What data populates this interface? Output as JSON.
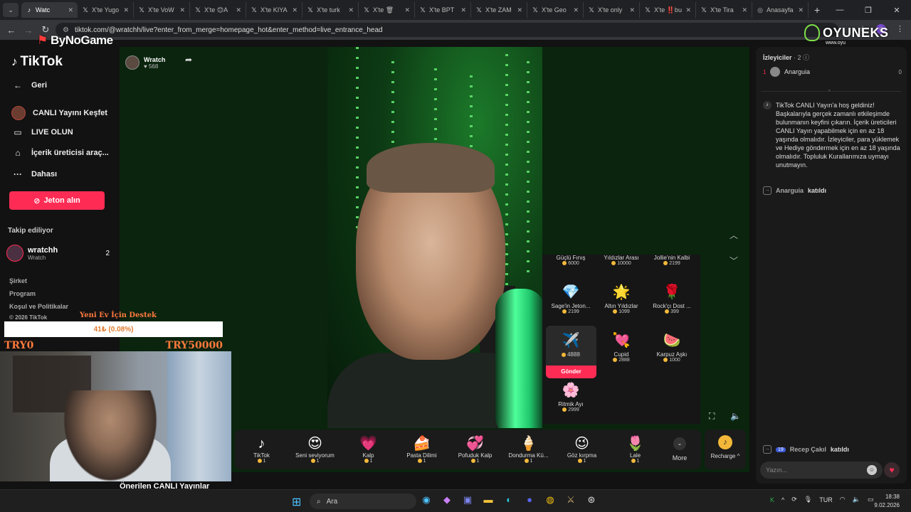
{
  "browser": {
    "tabs": [
      {
        "icon": "tiktok",
        "label": "Watc",
        "active": true
      },
      {
        "icon": "x",
        "label": "X'te Yugo"
      },
      {
        "icon": "x",
        "label": "X'te VoW"
      },
      {
        "icon": "x",
        "label": "X'te 😊A"
      },
      {
        "icon": "x",
        "label": "X'te KIYA"
      },
      {
        "icon": "x",
        "label": "X'te turk"
      },
      {
        "icon": "x",
        "label": "X'te 🗑"
      },
      {
        "icon": "x",
        "label": "X'te BPT"
      },
      {
        "icon": "x",
        "label": "X'te ZAM"
      },
      {
        "icon": "x",
        "label": "X'te Geo"
      },
      {
        "icon": "x",
        "label": "X'te only"
      },
      {
        "icon": "x",
        "label": "X'te ‼️bu"
      },
      {
        "icon": "x",
        "label": "X'te Tira"
      },
      {
        "icon": "globe",
        "label": "Anasayfa"
      }
    ],
    "url": "tiktok.com/@wratchh/live?enter_from_merge=homepage_hot&enter_method=live_entrance_head",
    "profile_initial": "C"
  },
  "overlay": {
    "bynogame": "ByNoGame",
    "oyuneks_brand": "OYUNEKS",
    "oyuneks_sub": "www.oyu",
    "donation_title": "Yeni Ev İçin Destek",
    "donation_progress": "41₺ (0.08%)",
    "donation_min": "TRY0",
    "donation_max": "TRY50000",
    "suggested_live": "Önerilen CANLI Yayınlar"
  },
  "sidebar": {
    "logo": "TikTok",
    "back": "Geri",
    "items": [
      {
        "icon": "avatar",
        "label": "CANLI Yayını Keşfet"
      },
      {
        "icon": "camera-icon",
        "label": "LIVE OLUN"
      },
      {
        "icon": "creator-icon",
        "label": "İçerik üreticisi araç..."
      },
      {
        "icon": "more-icon",
        "label": "Dahası"
      }
    ],
    "coin_button": "Jeton alın",
    "following_header": "Takip ediliyor",
    "followed_user": {
      "name": "wratchh",
      "sub": "Wratch",
      "count": "2"
    },
    "footer": [
      "Şirket",
      "Program",
      "Koşul ve Politikalar",
      "© 2026 TikTok"
    ]
  },
  "stream": {
    "host_name": "Wratch",
    "host_likes": "568"
  },
  "gift_panel": {
    "row0": [
      {
        "name": "Güçlü Fınış",
        "price": "6000"
      },
      {
        "name": "Yıldızlar Arası",
        "price": "10000"
      },
      {
        "name": "Jollie'nin Kalbi",
        "price": "2199"
      }
    ],
    "row1": [
      {
        "icon": "💎",
        "name": "Sage'in Jeton...",
        "price": "2199"
      },
      {
        "icon": "🌟",
        "name": "Altın Yıldızlar",
        "price": "1099"
      },
      {
        "icon": "🌹",
        "name": "Rock'çı Dost ...",
        "price": "399"
      }
    ],
    "row2": [
      {
        "icon": "✈️",
        "name": "",
        "price": "4888",
        "selected": true
      },
      {
        "icon": "💘",
        "name": "Cupid",
        "price": "2888"
      },
      {
        "icon": "🍉",
        "name": "Karpuz Aşkı",
        "price": "1000"
      }
    ],
    "row3": [
      {
        "icon": "🌸",
        "name": "Ritmik Ayı",
        "price": "2999"
      }
    ],
    "send_label": "Gönder"
  },
  "gift_bar": {
    "items": [
      {
        "icon": "♪",
        "name": "TikTok",
        "price": "1"
      },
      {
        "icon": "😍",
        "name": "Seni seviyorum",
        "price": "1"
      },
      {
        "icon": "💗",
        "name": "Kalp",
        "price": "1"
      },
      {
        "icon": "🍰",
        "name": "Pasta Dilimi",
        "price": "1"
      },
      {
        "icon": "💞",
        "name": "Pofuduk Kalp",
        "price": "1"
      },
      {
        "icon": "🍦",
        "name": "Dondurma Kü...",
        "price": "1"
      },
      {
        "icon": "😉",
        "name": "Göz kırpma",
        "price": "1"
      },
      {
        "icon": "🌷",
        "name": "Lale",
        "price": "1"
      }
    ],
    "more": "More",
    "recharge": "Recharge"
  },
  "chat": {
    "viewers_label": "İzleyiciler",
    "viewers_count": "· 2",
    "top_viewer": {
      "rank": "1",
      "name": "Anarguia",
      "score": "0"
    },
    "welcome": "TikTok CANLI Yayın'a hoş geldiniz! Başkalarıyla gerçek zamanlı etkileşimde bulunmanın keyfini çıkarın. İçerik üreticileri CANLI Yayın yapabilmek için en az 18 yaşında olmalıdır. İzleyiciler, para yüklemek ve Hediye göndermek için en az 18 yaşında olmalıdır. Topluluk Kurallarımıza uymayı unutmayın.",
    "joined1": {
      "user": "Anarguia",
      "action": "katıldı"
    },
    "joined2": {
      "level": "19",
      "user": "Recep Çakıl",
      "action": "katıldı"
    },
    "input_placeholder": "Yazın..."
  },
  "taskbar": {
    "search": "Ara",
    "lang": "TUR",
    "time": "18:38",
    "date": "9.02.2026"
  }
}
